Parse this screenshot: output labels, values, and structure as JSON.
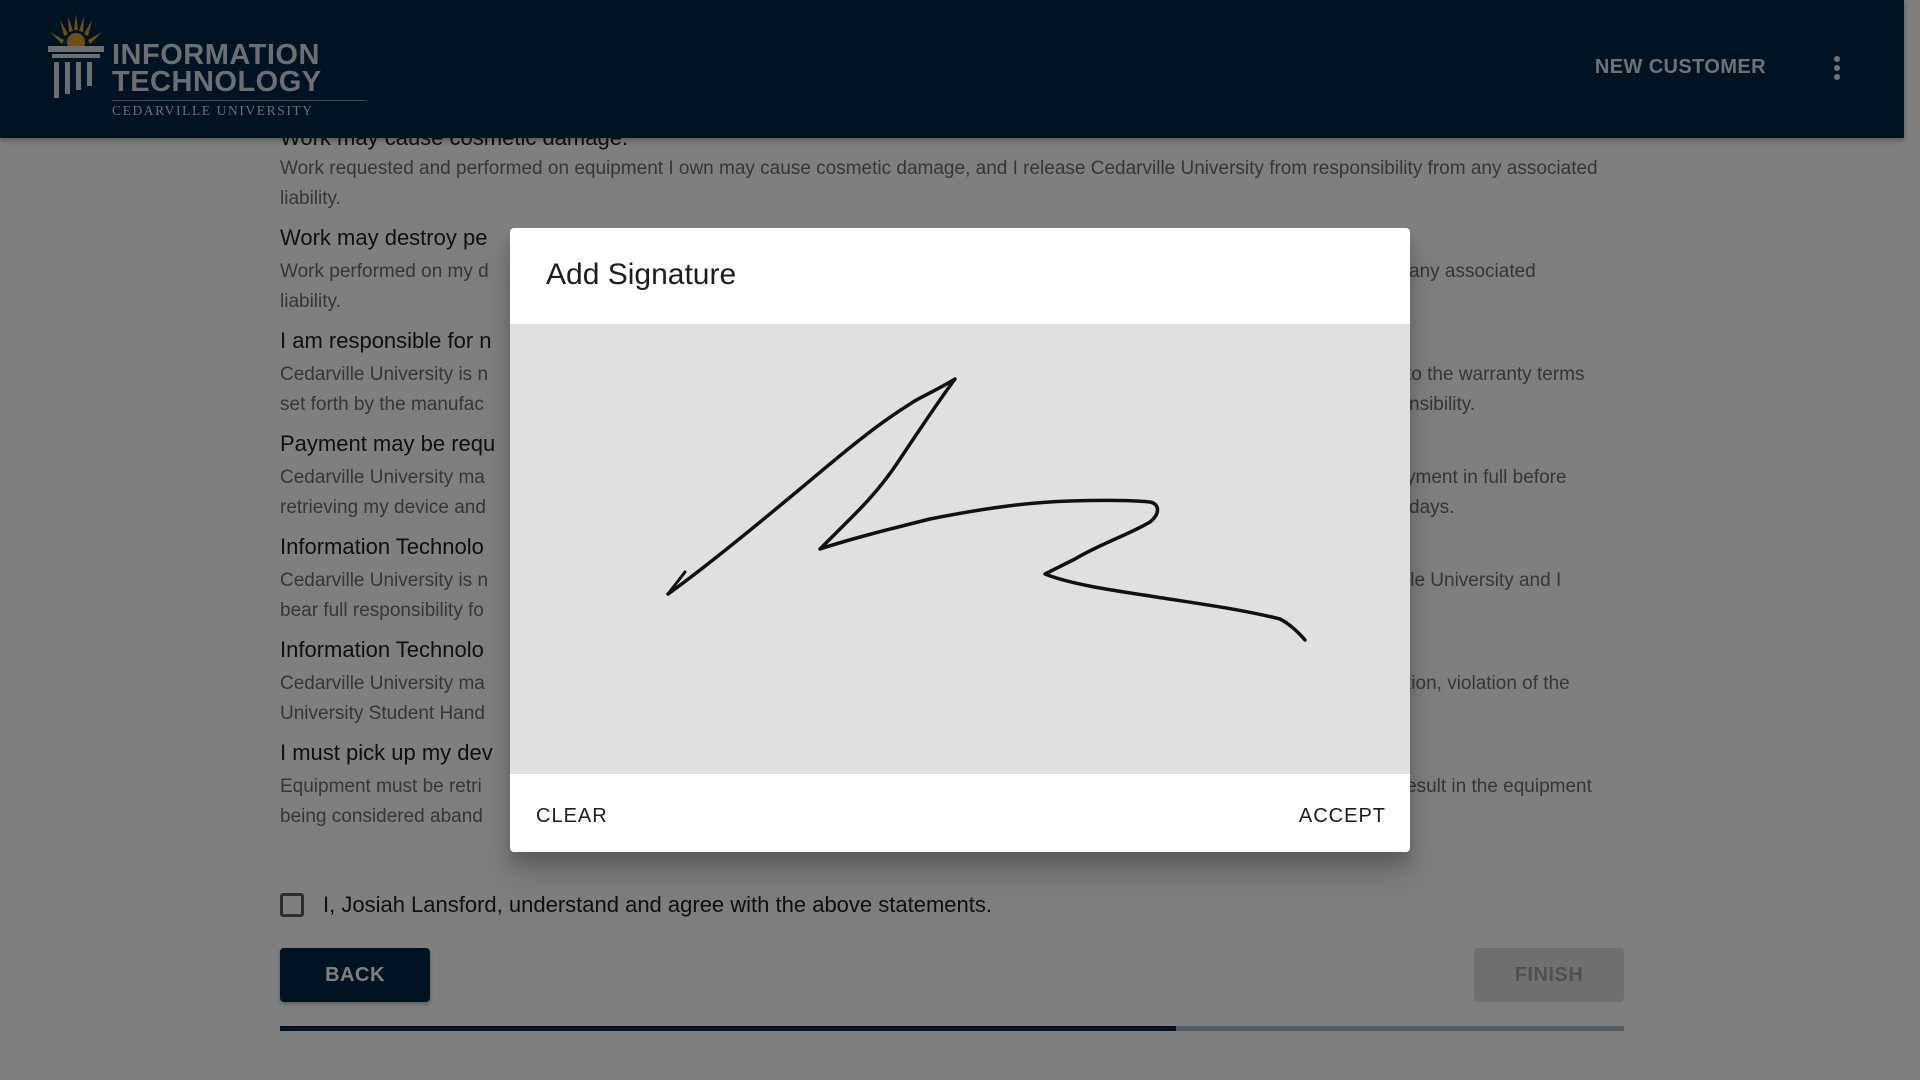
{
  "header": {
    "logo_line1": "INFORMATION",
    "logo_line2": "TECHNOLOGY",
    "logo_line3": "CEDARVILLE UNIVERSITY",
    "new_customer_label": "NEW CUSTOMER",
    "menu_icon": "more-vert-icon"
  },
  "statements": [
    {
      "title": "Work may cause cosmetic damage.",
      "body": "Work requested and performed on equipment I own may cause cosmetic damage, and I release Cedarville University from responsibility from any associated liability."
    },
    {
      "title": "Work may destroy pe",
      "body_left": "Work performed on my d",
      "body_right": "any associated",
      "body_line2": "liability."
    },
    {
      "title": "I am responsible for n",
      "body_left": "Cedarville University is n",
      "body_right": "to the warranty terms",
      "body_line2_left": "set forth by the manufac",
      "body_line2_right": "nsibility."
    },
    {
      "title": "Payment may be requ",
      "body_left": "Cedarville University ma",
      "body_right": "yment in full before",
      "body_line2_left": "retrieving my device and",
      "body_line2_right": "days."
    },
    {
      "title": "Information Technolo",
      "body_left": "Cedarville University is n",
      "body_right": "lle University and I",
      "body_line2_left": "bear full responsibility fo",
      "body_line2_right": ""
    },
    {
      "title": "Information Technolo",
      "body_left": "Cedarville University ma",
      "body_right": "tion, violation of the",
      "body_line2_left": "University Student Hand",
      "body_line2_right": ""
    },
    {
      "title": "I must pick up my dev",
      "body_left": "Equipment must be retri",
      "body_right": "esult in the equipment",
      "body_line2_left": "being considered aband",
      "body_line2_right": ""
    }
  ],
  "agreement": {
    "label": "I, Josiah Lansford, understand and agree with the above statements.",
    "checked": false
  },
  "buttons": {
    "back_label": "BACK",
    "finish_label": "FINISH"
  },
  "progress": {
    "fraction": 0.667
  },
  "dialog": {
    "title": "Add Signature",
    "clear_label": "CLEAR",
    "accept_label": "ACCEPT"
  },
  "colors": {
    "brand": "#012647",
    "overlay": "rgba(0,0,0,0.5)",
    "signature_pad": "#e0e0e0"
  }
}
